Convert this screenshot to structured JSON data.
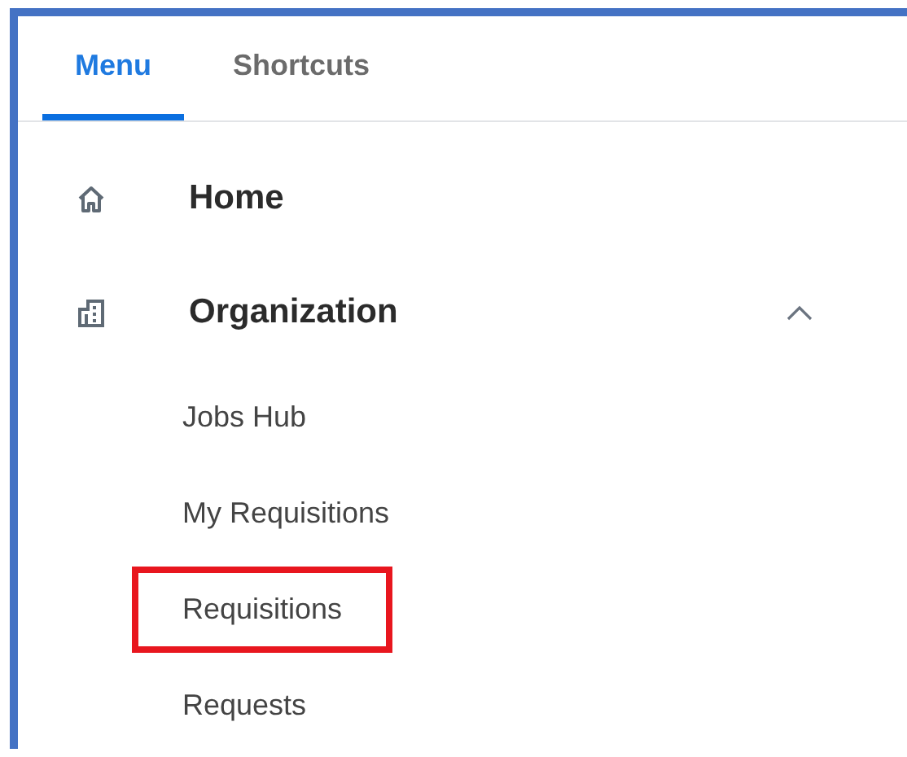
{
  "tabs": [
    {
      "label": "Menu",
      "selected": true
    },
    {
      "label": "Shortcuts",
      "selected": false
    }
  ],
  "menu": [
    {
      "label": "Home",
      "kind": "link"
    },
    {
      "label": "Organization",
      "kind": "group",
      "expanded": true,
      "children": [
        {
          "label": "Jobs Hub",
          "highlighted": false
        },
        {
          "label": "My Requisitions",
          "highlighted": false
        },
        {
          "label": "Requisitions",
          "highlighted": true
        },
        {
          "label": "Requests",
          "highlighted": false
        }
      ]
    }
  ]
}
